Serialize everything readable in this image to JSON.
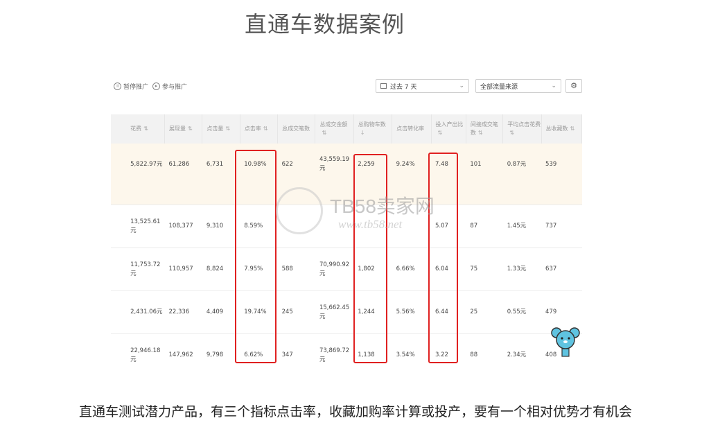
{
  "page_title": "直通车数据案例",
  "caption": "直通车测试潜力产品，有三个指标点击率，收藏加购率计算或投产，要有一个相对优势才有机会",
  "toolbar": {
    "pause_label": "暂停推广",
    "join_label": "参与推广",
    "date_range": "过去 7 天",
    "traffic_source": "全部流量来源"
  },
  "table": {
    "headers": [
      "花费",
      "展现量",
      "点击量",
      "点击率",
      "总成交笔数",
      "总成交金额",
      "总购物车数",
      "点击转化率",
      "投入产出比",
      "间接成交笔数",
      "平均点击花费",
      "总收藏数"
    ],
    "rows": [
      [
        "5,822.97元",
        "61,286",
        "6,731",
        "10.98%",
        "622",
        "43,559.19元",
        "2,259",
        "9.24%",
        "7.48",
        "101",
        "0.87元",
        "539"
      ],
      [
        "13,525.61元",
        "108,377",
        "9,310",
        "8.59%",
        "",
        "",
        "",
        "",
        "5.07",
        "87",
        "1.45元",
        "737"
      ],
      [
        "11,753.72元",
        "110,957",
        "8,824",
        "7.95%",
        "588",
        "70,990.92元",
        "1,802",
        "6.66%",
        "6.04",
        "75",
        "1.33元",
        "637"
      ],
      [
        "2,431.06元",
        "22,336",
        "4,409",
        "19.74%",
        "245",
        "15,662.45元",
        "1,244",
        "5.56%",
        "6.44",
        "25",
        "0.55元",
        "479"
      ],
      [
        "22,946.18元",
        "147,962",
        "9,798",
        "6.62%",
        "347",
        "73,869.72元",
        "1,138",
        "3.54%",
        "3.22",
        "88",
        "2.34元",
        "408"
      ]
    ]
  },
  "watermark": {
    "brand": "TB58卖家网",
    "url": "www.tb58.net"
  },
  "colors": {
    "highlight_box": "#e02020",
    "highlight_row": "#fdf7ec",
    "header_bg": "#f2f2f2"
  }
}
